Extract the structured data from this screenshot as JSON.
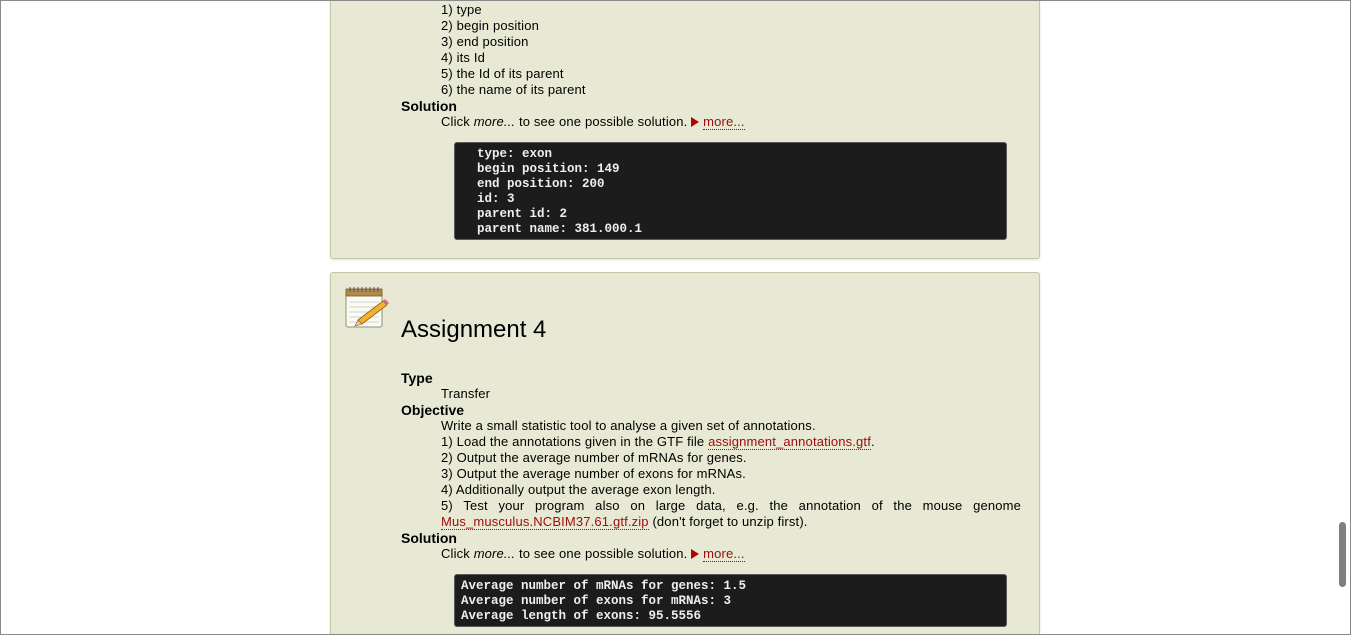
{
  "assignment3": {
    "objective_items": [
      "1) type",
      "2) begin position",
      "3) end position",
      "4) its Id",
      "5) the Id of its parent",
      "6) the name of its parent"
    ],
    "solution_label": "Solution",
    "solution_prefix": "Click",
    "solution_more_word": "more...",
    "solution_suffix": "to see one possible solution.",
    "more_link": "more...",
    "code_lines": [
      "type: exon",
      "begin position: 149",
      "end position: 200",
      "id: 3",
      "parent id: 2",
      "parent name: 381.000.1"
    ]
  },
  "assignment4": {
    "title": "Assignment 4",
    "icon": "notepad-pencil-icon",
    "type_label": "Type",
    "type_value": "Transfer",
    "objective_label": "Objective",
    "objective_intro": "Write a small statistic tool to analyse a given set of annotations.",
    "item1_prefix": "1) Load the annotations given in the GTF file",
    "item1_link": "assignment_annotations.gtf",
    "item1_suffix": ".",
    "item2": "2) Output the average number of mRNAs for genes.",
    "item3": "3) Output the average number of exons for mRNAs.",
    "item4": "4) Additionally output the average exon length.",
    "item5_text": "5) Test your program also on large data, e.g. the annotation of the mouse genome",
    "item5_link": "Mus_musculus.NCBIM37.61.gtf.zip",
    "item5_suffix": "(don't forget to unzip first).",
    "solution_label": "Solution",
    "solution_prefix": "Click",
    "solution_more_word": "more...",
    "solution_suffix": "to see one possible solution.",
    "more_link": "more...",
    "code_lines": [
      "Average number of mRNAs for genes: 1.5",
      "Average number of exons for mRNAs: 3",
      "Average length of exons: 95.5556"
    ]
  },
  "colors": {
    "box_background": "#e8e9d4",
    "link": "#a10c0c",
    "code_background": "#1c1c1c"
  }
}
